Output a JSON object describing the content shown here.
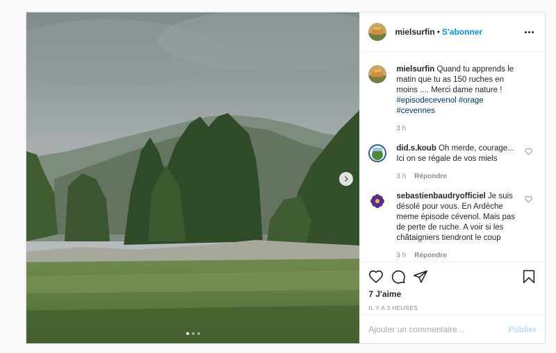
{
  "post": {
    "photo": {
      "description_icon": "carousel-photo",
      "next_icon": "chevron-right-icon",
      "slide_count": 3,
      "active_slide": 1
    },
    "header": {
      "username": "mielsurfin",
      "separator": "•",
      "follow_label": "S'abonner",
      "more_icon": "more-options-icon"
    },
    "caption": {
      "username": "mielsurfin",
      "text": "Quand tu apprends le matin que tu as 150 ruches en moins .... Merci dame nature ! ",
      "hashtags": [
        "#episodecevenol",
        "#orage",
        "#cevennes"
      ],
      "time": "3 h"
    },
    "comments": [
      {
        "username": "did.s.koub",
        "text": "Oh merde, courage... Ici on se régale de vos miels",
        "time": "3 h",
        "reply_label": "Répondre"
      },
      {
        "username": "sebastienbaudryofficiel",
        "text": "Je suis désolé pour vous. En Ardèche meme épisode cévenol. Mais pas de perte de ruche. A voir si les châtaigniers tiendront le coup",
        "time": "3 h",
        "reply_label": "Répondre"
      }
    ],
    "actions": {
      "icons": [
        "heart-icon",
        "comment-icon",
        "share-icon",
        "bookmark-icon"
      ],
      "likes": "7 J'aime",
      "time_ago": "IL Y A 3 HEURES"
    },
    "add_comment": {
      "placeholder": "Ajouter un commentaire...",
      "publish_label": "Publier"
    }
  },
  "colors": {
    "accent": "#0095f6",
    "publish_disabled": "#b2dffc",
    "hashtag": "#00376b",
    "muted": "#8e8e8e"
  }
}
